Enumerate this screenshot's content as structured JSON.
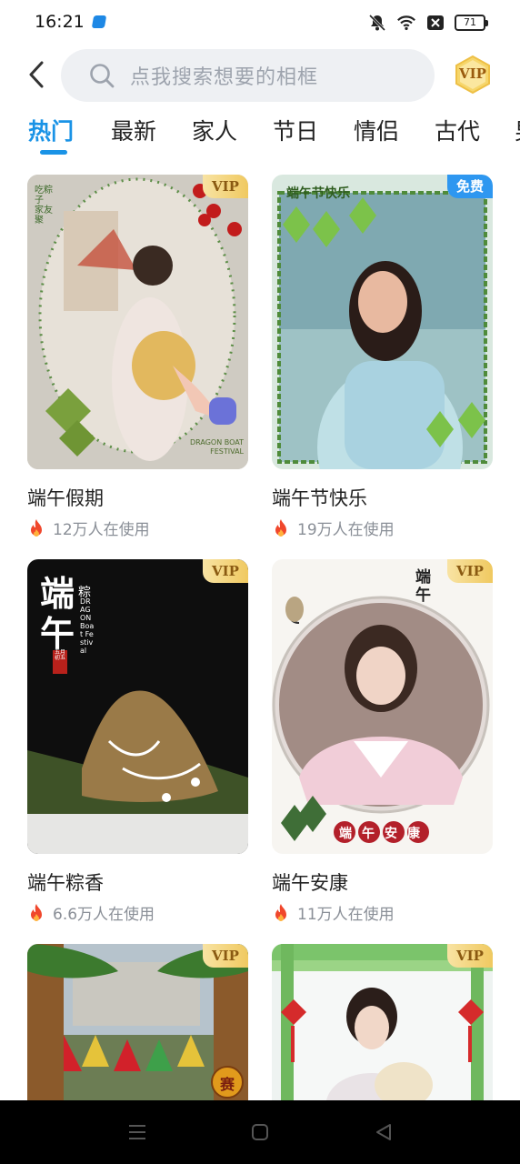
{
  "status_bar": {
    "time": "16:21",
    "battery": "71",
    "icons": [
      "app-notification-icon",
      "mute-icon",
      "wifi-icon",
      "close-box-icon",
      "battery-icon"
    ]
  },
  "header": {
    "back_icon": "chevron-left-icon",
    "search_placeholder": "点我搜索想要的相框",
    "vip_label": "VIP"
  },
  "tabs": [
    {
      "label": "热门",
      "active": true
    },
    {
      "label": "最新",
      "active": false
    },
    {
      "label": "家人",
      "active": false
    },
    {
      "label": "节日",
      "active": false
    },
    {
      "label": "情侣",
      "active": false
    },
    {
      "label": "古代",
      "active": false
    },
    {
      "label": "男",
      "active": false
    }
  ],
  "cards": [
    {
      "title": "端午假期",
      "usage": "12万人在使用",
      "tag": "VIP",
      "image": {
        "caption_top": "吃粽子 家友聚",
        "caption_bottom": "DRAGON BOAT FESTIVAL"
      }
    },
    {
      "title": "端午节快乐",
      "usage": "19万人在使用",
      "tag": "免费",
      "image": {
        "banner": "端午节快乐"
      }
    },
    {
      "title": "端午粽香",
      "usage": "6.6万人在使用",
      "tag": "VIP",
      "image": {
        "calligraphy": "端午",
        "small": "粽",
        "seal": "五月初五",
        "english": "DRAGON Boat Festival"
      }
    },
    {
      "title": "端午安康",
      "usage": "11万人在使用",
      "tag": "VIP",
      "image": {
        "calligraphy": "端午",
        "blessing": "端午安康"
      }
    },
    {
      "title": "",
      "usage": "",
      "tag": "VIP",
      "image": {
        "badge": "赛"
      }
    },
    {
      "title": "",
      "usage": "",
      "tag": "VIP",
      "image": {}
    }
  ],
  "nav": {
    "icons": [
      "menu-icon",
      "home-icon",
      "back-triangle-icon"
    ]
  },
  "colors": {
    "accent": "#1a93e6",
    "fire": "#f0472c",
    "vip_gold": "#f0c960",
    "free_blue": "#2e97f0"
  }
}
